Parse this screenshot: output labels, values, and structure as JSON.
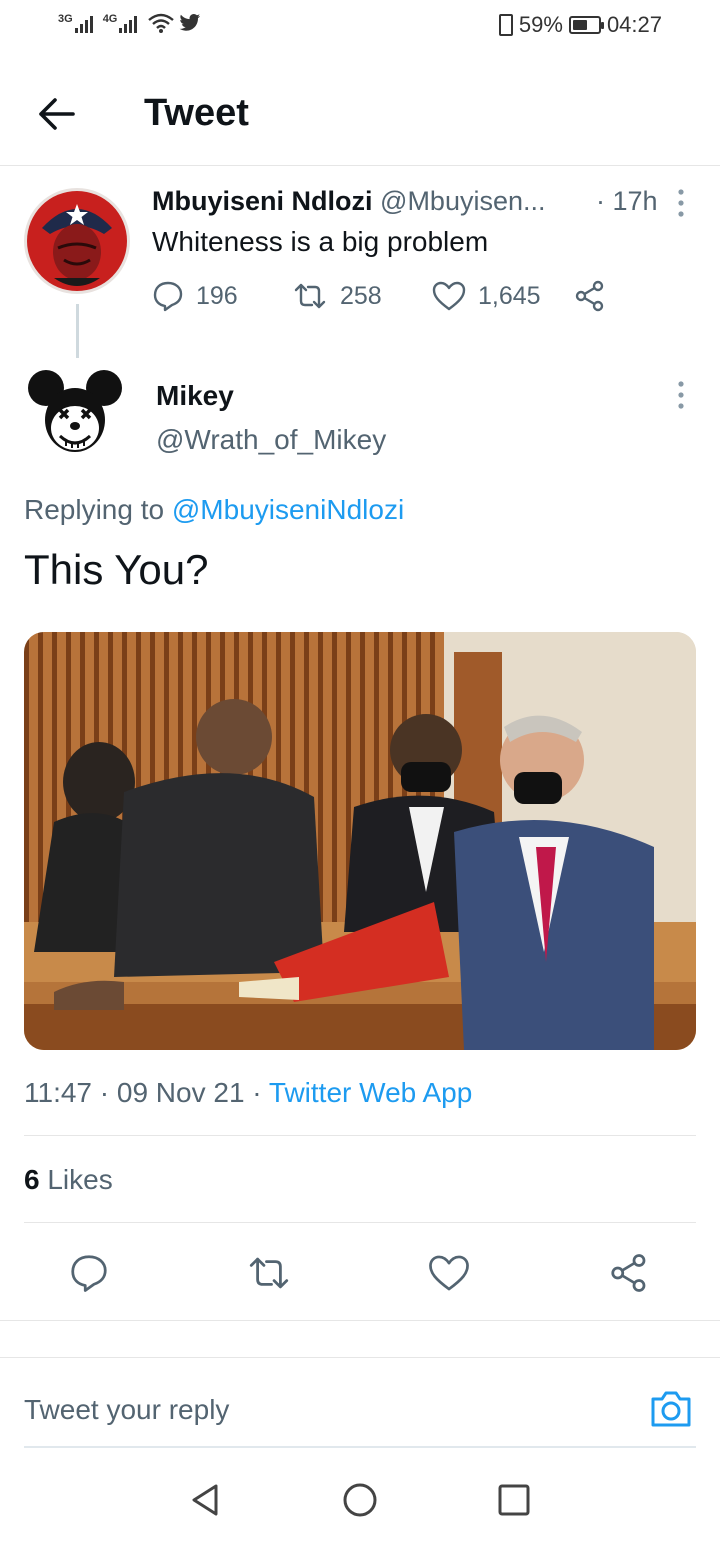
{
  "status_bar": {
    "network_1": "3G",
    "network_2": "4G",
    "battery_percent": "59%",
    "battery_level": 0.59,
    "time": "04:27",
    "icons": [
      "signal-icon",
      "signal-icon",
      "wifi-icon",
      "twitter-bird-icon",
      "vibrate-icon",
      "battery-icon"
    ]
  },
  "header": {
    "title": "Tweet",
    "back_icon": "arrow-left-icon"
  },
  "parent_tweet": {
    "name": "Mbuyiseni Ndlozi",
    "handle": "@Mbuyisen...",
    "time": "· 17h",
    "text": "Whiteness is a big problem",
    "replies": "196",
    "retweets": "258",
    "likes": "1,645"
  },
  "tweet": {
    "name": "Mikey",
    "handle": "@Wrath_of_Mikey",
    "replying_prefix": "Replying to",
    "replying_to": "@MbuyiseniNdlozi",
    "text": "This You?",
    "timestamp": "11:47 · 09 Nov 21 ·",
    "source": "Twitter Web App",
    "likes_count": "6",
    "likes_label": "Likes"
  },
  "reply_box": {
    "placeholder": "Tweet your reply"
  },
  "colors": {
    "accent": "#1d9bf0",
    "text_primary": "#0f1419",
    "text_secondary": "#536471",
    "divider": "#e6e6e6"
  }
}
